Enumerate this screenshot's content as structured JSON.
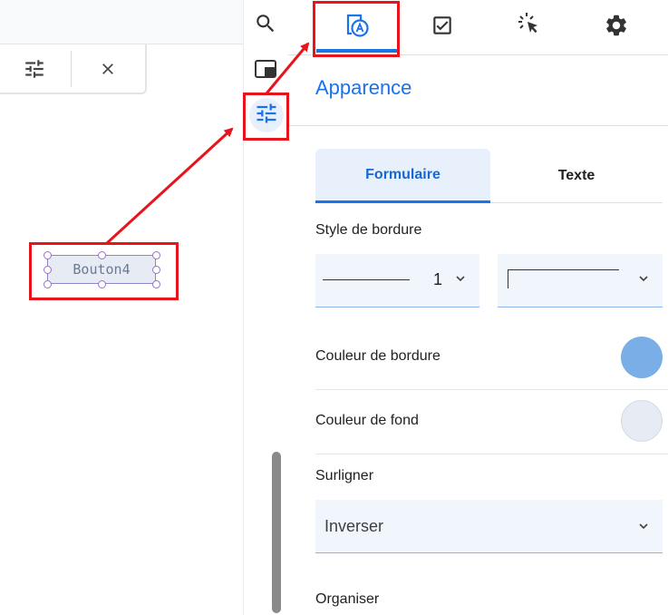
{
  "canvas": {
    "button_label": "Bouton4"
  },
  "panel": {
    "title": "Apparence",
    "tabs": [
      {
        "name": "appearance",
        "icon": "appearance-icon",
        "active": true
      },
      {
        "name": "validation",
        "icon": "checkbox-icon",
        "active": false
      },
      {
        "name": "events",
        "icon": "click-icon",
        "active": false
      },
      {
        "name": "settings",
        "icon": "gear-icon",
        "active": false
      }
    ],
    "subtabs": {
      "form": "Formulaire",
      "text": "Texte"
    },
    "border_style": {
      "label": "Style de bordure",
      "width_value": "1"
    },
    "border_color": {
      "label": "Couleur de bordure",
      "color": "#7aaee6"
    },
    "fill_color": {
      "label": "Couleur de fond",
      "color": "#e6ebf4"
    },
    "highlight": {
      "label": "Surligner",
      "value": "Inverser"
    },
    "arrange": {
      "label": "Organiser"
    }
  },
  "colors": {
    "accent": "#1a73e8",
    "annotation": "#e8141c"
  }
}
